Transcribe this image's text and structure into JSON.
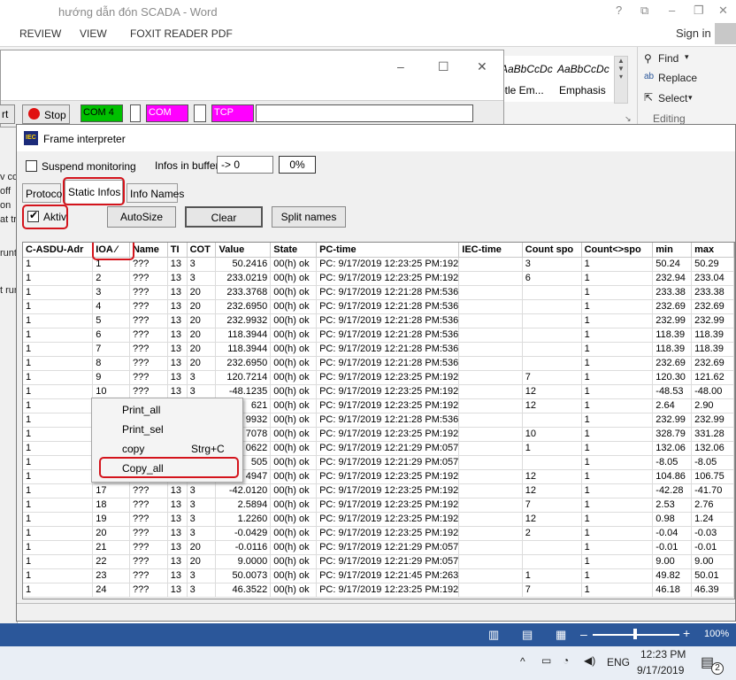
{
  "word": {
    "title": "hướng dẫn đón SCADA - Word",
    "tabs": [
      "REVIEW",
      "VIEW",
      "FOXIT READER PDF"
    ],
    "sign_in": "Sign in",
    "styles": [
      "AaBbCcDc",
      "AaBbCcDc"
    ],
    "style_names": [
      "btle Em...",
      "Emphasis"
    ],
    "find": "Find",
    "replace": "Replace",
    "select": "Select",
    "editing": "Editing",
    "zoom": "100%"
  },
  "bgapp": {
    "start_label": "rt",
    "stop_label": "Stop",
    "com4": "COM 4",
    "com": "COM",
    "tcp": "TCP",
    "strip": [
      "v co",
      "off",
      "on",
      "at tr",
      "runt",
      "t run"
    ],
    "com4_color": "#00c000",
    "com_color": "#ff00ff"
  },
  "fi": {
    "title": "Frame interpreter",
    "suspend": "Suspend monitoring",
    "infos_in_buffer": "Infos in buffer",
    "buffer_value": "-> 0",
    "percent": "0%",
    "tabs": [
      "Protocol",
      "Static Infos",
      "Info Names"
    ],
    "aktiv": "Aktiv",
    "autosize": "AutoSize",
    "clear": "Clear",
    "split_names": "Split names",
    "columns": [
      "C-ASDU-Adr",
      "IOA ⁄",
      "Name",
      "TI",
      "COT",
      "Value",
      "State",
      "PC-time",
      "IEC-time",
      "Count spo",
      "Count<>spo",
      "min",
      "max"
    ],
    "rows": [
      [
        "1",
        "1",
        "???",
        "13",
        "3",
        "50.2416",
        "00(h) ok",
        "PC: 9/17/2019 12:23:25 PM:192",
        "",
        "3",
        "1",
        "50.24",
        "50.29"
      ],
      [
        "1",
        "2",
        "???",
        "13",
        "3",
        "233.0219",
        "00(h) ok",
        "PC: 9/17/2019 12:23:25 PM:192",
        "",
        "6",
        "1",
        "232.94",
        "233.04"
      ],
      [
        "1",
        "3",
        "???",
        "13",
        "20",
        "233.3768",
        "00(h) ok",
        "PC: 9/17/2019 12:21:28 PM:536",
        "",
        "",
        "1",
        "233.38",
        "233.38"
      ],
      [
        "1",
        "4",
        "???",
        "13",
        "20",
        "232.6950",
        "00(h) ok",
        "PC: 9/17/2019 12:21:28 PM:536",
        "",
        "",
        "1",
        "232.69",
        "232.69"
      ],
      [
        "1",
        "5",
        "???",
        "13",
        "20",
        "232.9932",
        "00(h) ok",
        "PC: 9/17/2019 12:21:28 PM:536",
        "",
        "",
        "1",
        "232.99",
        "232.99"
      ],
      [
        "1",
        "6",
        "???",
        "13",
        "20",
        "118.3944",
        "00(h) ok",
        "PC: 9/17/2019 12:21:28 PM:536",
        "",
        "",
        "1",
        "118.39",
        "118.39"
      ],
      [
        "1",
        "7",
        "???",
        "13",
        "20",
        "118.3944",
        "00(h) ok",
        "PC: 9/17/2019 12:21:28 PM:536",
        "",
        "",
        "1",
        "118.39",
        "118.39"
      ],
      [
        "1",
        "8",
        "???",
        "13",
        "20",
        "232.6950",
        "00(h) ok",
        "PC: 9/17/2019 12:21:28 PM:536",
        "",
        "",
        "1",
        "232.69",
        "232.69"
      ],
      [
        "1",
        "9",
        "???",
        "13",
        "3",
        "120.7214",
        "00(h) ok",
        "PC: 9/17/2019 12:23:25 PM:192",
        "",
        "7",
        "1",
        "120.30",
        "121.62"
      ],
      [
        "1",
        "10",
        "???",
        "13",
        "3",
        "-48.1235",
        "00(h) ok",
        "PC: 9/17/2019 12:23:25 PM:192",
        "",
        "12",
        "1",
        "-48.53",
        "-48.00"
      ],
      [
        "1",
        "",
        "",
        "",
        "",
        "621",
        "00(h) ok",
        "PC: 9/17/2019 12:23:25 PM:192",
        "",
        "12",
        "1",
        "2.64",
        "2.90"
      ],
      [
        "1",
        "",
        "",
        "",
        "",
        "9932",
        "00(h) ok",
        "PC: 9/17/2019 12:21:28 PM:536",
        "",
        "",
        "1",
        "232.99",
        "232.99"
      ],
      [
        "1",
        "",
        "",
        "",
        "",
        "7078",
        "00(h) ok",
        "PC: 9/17/2019 12:23:25 PM:192",
        "",
        "10",
        "1",
        "328.79",
        "331.28"
      ],
      [
        "1",
        "",
        "",
        "",
        "",
        "0622",
        "00(h) ok",
        "PC: 9/17/2019 12:21:29 PM:057",
        "",
        "1",
        "1",
        "132.06",
        "132.06"
      ],
      [
        "1",
        "",
        "",
        "",
        "",
        "505",
        "00(h) ok",
        "PC: 9/17/2019 12:21:29 PM:057",
        "",
        "",
        "1",
        "-8.05",
        "-8.05"
      ],
      [
        "1",
        "",
        "",
        "",
        "",
        "4947",
        "00(h) ok",
        "PC: 9/17/2019 12:23:25 PM:192",
        "",
        "12",
        "1",
        "104.86",
        "106.75"
      ],
      [
        "1",
        "17",
        "???",
        "13",
        "3",
        "-42.0120",
        "00(h) ok",
        "PC: 9/17/2019 12:23:25 PM:192",
        "",
        "12",
        "1",
        "-42.28",
        "-41.70"
      ],
      [
        "1",
        "18",
        "???",
        "13",
        "3",
        "2.5894",
        "00(h) ok",
        "PC: 9/17/2019 12:23:25 PM:192",
        "",
        "7",
        "1",
        "2.53",
        "2.76"
      ],
      [
        "1",
        "19",
        "???",
        "13",
        "3",
        "1.2260",
        "00(h) ok",
        "PC: 9/17/2019 12:23:25 PM:192",
        "",
        "12",
        "1",
        "0.98",
        "1.24"
      ],
      [
        "1",
        "20",
        "???",
        "13",
        "3",
        "-0.0429",
        "00(h) ok",
        "PC: 9/17/2019 12:23:25 PM:192",
        "",
        "2",
        "1",
        "-0.04",
        "-0.03"
      ],
      [
        "1",
        "21",
        "???",
        "13",
        "20",
        "-0.0116",
        "00(h) ok",
        "PC: 9/17/2019 12:21:29 PM:057",
        "",
        "",
        "1",
        "-0.01",
        "-0.01"
      ],
      [
        "1",
        "22",
        "???",
        "13",
        "20",
        "9.0000",
        "00(h) ok",
        "PC: 9/17/2019 12:21:29 PM:057",
        "",
        "",
        "1",
        "9.00",
        "9.00"
      ],
      [
        "1",
        "23",
        "???",
        "13",
        "3",
        "50.0073",
        "00(h) ok",
        "PC: 9/17/2019 12:21:45 PM:263",
        "",
        "1",
        "1",
        "49.82",
        "50.01"
      ],
      [
        "1",
        "24",
        "???",
        "13",
        "3",
        "46.3522",
        "00(h) ok",
        "PC: 9/17/2019 12:23:25 PM:192",
        "",
        "7",
        "1",
        "46.18",
        "46.39"
      ]
    ]
  },
  "context_menu": {
    "items": [
      "Print_all",
      "Print_sel",
      "copy",
      "Copy_all"
    ],
    "copy_shortcut": "Strg+C"
  },
  "taskbar": {
    "lang": "ENG",
    "time": "12:23 PM",
    "date": "9/17/2019",
    "notifications": "2"
  }
}
